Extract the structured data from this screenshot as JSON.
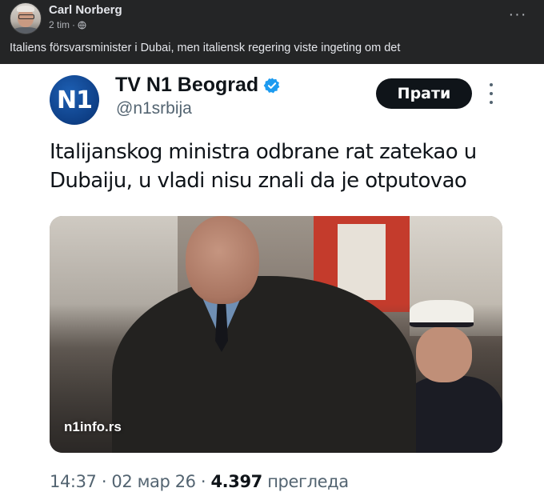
{
  "post": {
    "author": "Carl Norberg",
    "time": "2 tim",
    "separator": "·",
    "text": "Italiens försvarsminister i Dubai, men italiensk regering viste ingeting om det",
    "more_label": "···"
  },
  "tweet": {
    "logo_text": "N1",
    "account_name": "TV N1 Beograd",
    "handle": "@n1srbija",
    "follow_label": "Прати",
    "text": "Italijanskog ministra odbrane rat zatekao u Dubaiju, u vladi nisu znali da je otputovao",
    "image_watermark": "n1info.rs",
    "time": "14:37",
    "dot1": "·",
    "date": "02 мар 26",
    "dot2": "·",
    "views": "4.397",
    "views_label": "прегледа"
  },
  "colors": {
    "background_dark": "#242526",
    "verified": "#1d9bf0",
    "follow_bg": "#0f1419"
  }
}
